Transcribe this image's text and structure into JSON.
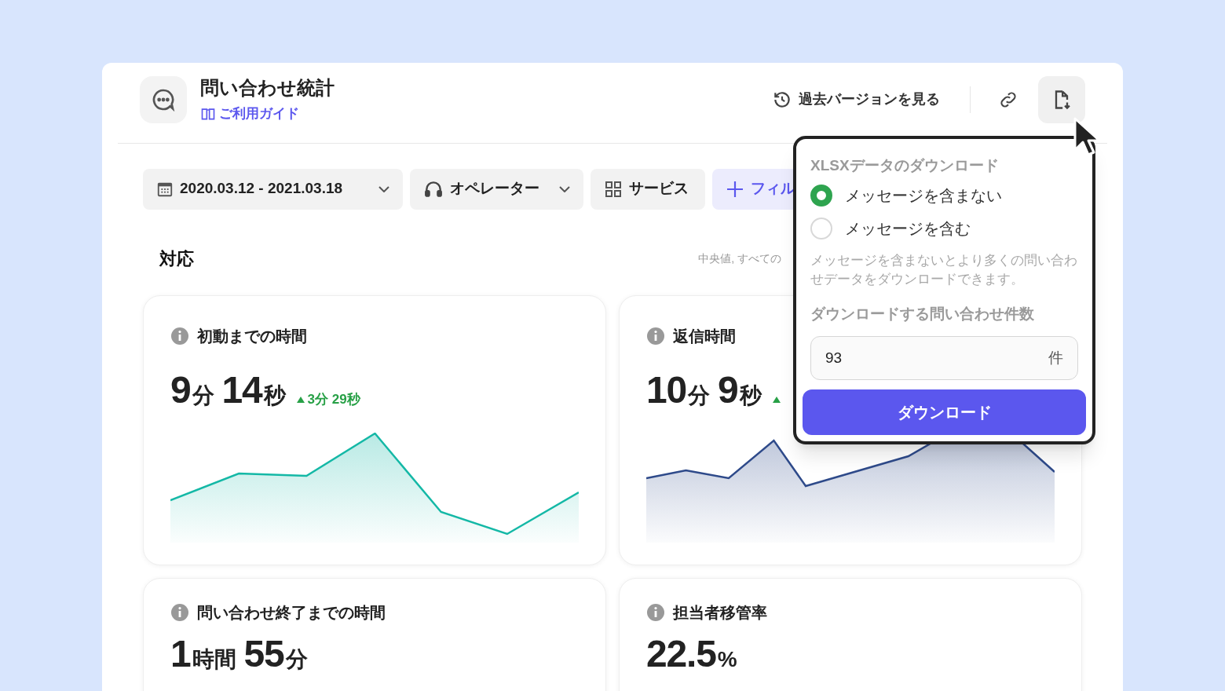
{
  "header": {
    "title": "問い合わせ統計",
    "guide_link": "ご利用ガイド",
    "history_button": "過去バージョンを見る",
    "export_button": {
      "selected": true
    }
  },
  "filters": [
    {
      "kind": "date",
      "label": "2020.03.12 - 2021.03.18",
      "dropdown": true
    },
    {
      "kind": "operator",
      "label": "オペレーター",
      "dropdown": true
    },
    {
      "kind": "service",
      "label": "サービス",
      "dropdown": false
    },
    {
      "kind": "add",
      "label": "フィル",
      "dropdown": false
    }
  ],
  "section": {
    "title": "対応",
    "note": "中央値, すべての"
  },
  "metrics": [
    {
      "title": "初動までの時間",
      "value": [
        {
          "number": "9",
          "unit": "分"
        },
        {
          "number": "14",
          "unit": "秒"
        }
      ],
      "delta": {
        "increase": true,
        "text": "3分 29秒"
      },
      "color": "#14b8a6"
    },
    {
      "title": "返信時間",
      "value": [
        {
          "number": "10",
          "unit": "分"
        },
        {
          "number": "9",
          "unit": "秒"
        }
      ],
      "delta": {
        "increase": true
      },
      "color": "#2e4a8a"
    },
    {
      "title": "問い合わせ終了までの時間",
      "value": [
        {
          "number": "1",
          "unit": "時間"
        },
        {
          "number": "55",
          "unit": "分"
        }
      ]
    },
    {
      "title": "担当者移管率",
      "value": [
        {
          "number": "22.5",
          "unit": "%"
        }
      ]
    }
  ],
  "export_popover": {
    "title": "XLSXデータのダウンロード",
    "options": [
      {
        "label": "メッセージを含まない",
        "selected": true
      },
      {
        "label": "メッセージを含む",
        "selected": false
      }
    ],
    "help": "メッセージを含まないとより多くの問い合わせデータをダウンロードできます。",
    "count_label": "ダウンロードする問い合わせ件数",
    "count_value": "93",
    "count_unit": "件",
    "button": "ダウンロード"
  }
}
